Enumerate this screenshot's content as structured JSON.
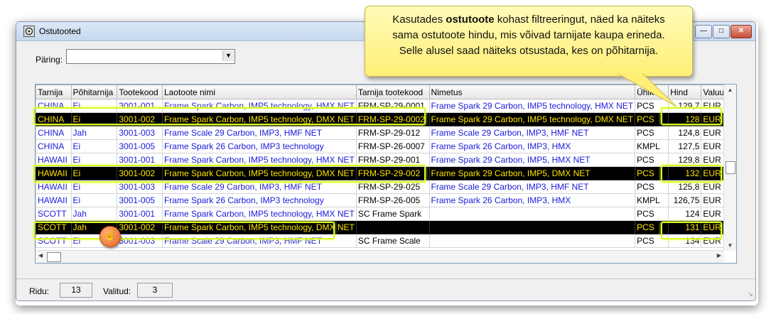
{
  "window": {
    "title": "Ostutooted",
    "controls": [
      "0",
      "=",
      "x"
    ]
  },
  "query": {
    "label": "Päring:",
    "value": ""
  },
  "columns": [
    "Tarnija",
    "Põhitarnija",
    "Tootekood",
    "Laotoote nimi",
    "Tarnija tootekood",
    "Nimetus",
    "Ühik",
    "Hind",
    "Valuuta"
  ],
  "rows": [
    {
      "highlight": false,
      "cells": [
        "CHINA",
        "Ei",
        "3001-001",
        "Frame Spark Carbon, IMP5 technology, HMX NET",
        "FRM-SP-29-0001",
        "Frame Spark 29 Carbon, IMP5 technology, HMX NET",
        "PCS",
        "129,7",
        "EUR"
      ]
    },
    {
      "highlight": true,
      "cells": [
        "CHINA",
        "Ei",
        "3001-002",
        "Frame Spark Carbon, IMP5 technology, DMX NET",
        "FRM-SP-29-0002",
        "Frame Spark 29 Carbon, IMP5 technology, DMX NET",
        "PCS",
        "128",
        "EUR"
      ]
    },
    {
      "highlight": false,
      "cells": [
        "CHINA",
        "Jah",
        "3001-003",
        "Frame Scale 29 Carbon, IMP3, HMF NET",
        "FRM-SP-29-012",
        "Frame Scale 29 Carbon, IMP3, HMF NET",
        "PCS",
        "124,8",
        "EUR"
      ]
    },
    {
      "highlight": false,
      "cells": [
        "CHINA",
        "Ei",
        "3001-005",
        "Frame Spark 26 Carbon, IMP3 technology",
        "FRM-SP-26-0007",
        "Frame Spark 26 Carbon, IMP3, HMX",
        "KMPL",
        "127,5",
        "EUR"
      ]
    },
    {
      "highlight": false,
      "cells": [
        "HAWAII",
        "Ei",
        "3001-001",
        "Frame Spark Carbon, IMP5 technology, HMX NET",
        "FRM-SP-29-001",
        "Frame Spark 29 Carbon, IMP5, HMX NET",
        "PCS",
        "129,8",
        "EUR"
      ]
    },
    {
      "highlight": true,
      "cells": [
        "HAWAII",
        "Ei",
        "3001-002",
        "Frame Spark Carbon, IMP5 technology, DMX NET",
        "FRM-SP-29-002",
        "Frame Spark 29 Carbon, IMP5, DMX NET",
        "PCS",
        "132",
        "EUR"
      ]
    },
    {
      "highlight": false,
      "cells": [
        "HAWAII",
        "Ei",
        "3001-003",
        "Frame Scale 29 Carbon, IMP3, HMF NET",
        "FRM-SP-29-025",
        "Frame Scale 29 Carbon, IMP3, HMF NET",
        "PCS",
        "125,8",
        "EUR"
      ]
    },
    {
      "highlight": false,
      "cells": [
        "HAWAII",
        "Ei",
        "3001-005",
        "Frame Spark 26 Carbon, IMP3 technology",
        "FRM-SP-26-005",
        "Frame Spark 26 Carbon, IMP3, HMX",
        "KMPL",
        "126,75",
        "EUR"
      ]
    },
    {
      "highlight": false,
      "cells": [
        "SCOTT",
        "Jah",
        "3001-001",
        "Frame Spark Carbon, IMP5 technology, HMX NET",
        "SC Frame Spark",
        "",
        "PCS",
        "124",
        "EUR"
      ]
    },
    {
      "highlight": true,
      "cells": [
        "SCOTT",
        "Jah",
        "3001-002",
        "Frame Spark Carbon, IMP5 technology, DMX NET",
        "",
        "",
        "PCS",
        "131",
        "EUR"
      ]
    },
    {
      "highlight": false,
      "cells": [
        "SCOTT",
        "Ei",
        "3001-003",
        "Frame Scale 29 Carbon, IMP3, HMF NET",
        "SC Frame Scale",
        "",
        "PCS",
        "134",
        "EUR"
      ]
    }
  ],
  "status": {
    "rows_label": "Ridu:",
    "rows_value": "13",
    "selected_label": "Valitud:",
    "selected_value": "3"
  },
  "callout": {
    "line1_prefix": "Kasutades ",
    "line1_bold": "ostutoote",
    "line1_suffix": " kohast filtreeringut, näed ka näiteks",
    "line2": "sama ostutoote hindu, mis võivad tarnijate kaupa erineda.",
    "line3": "Selle alusel saad näiteks otsustada, kes on põhitarnija."
  },
  "colors": {
    "link_text": "#1a1adb",
    "highlight_text": "#ffe600",
    "highlight_outline": "#d5ff1c",
    "callout_bg": "#fff27a"
  }
}
